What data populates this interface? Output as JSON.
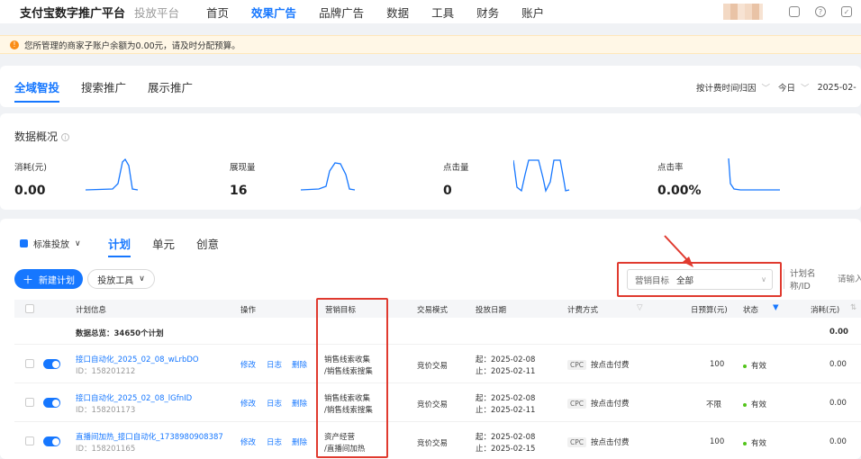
{
  "topbar": {
    "brand": "支付宝数字推广平台",
    "sub": "投放平台",
    "nav": [
      "首页",
      "效果广告",
      "品牌广告",
      "数据",
      "工具",
      "财务",
      "账户"
    ],
    "active_nav": "效果广告"
  },
  "notice": {
    "text": "您所管理的商家子账户余额为0.00元，请及时分配预算。"
  },
  "main_tabs": [
    "全域智投",
    "搜索推广",
    "展示推广"
  ],
  "tabs_right": {
    "attribution": "按计费时间归因",
    "date_range": "今日",
    "date": "2025-02-"
  },
  "overview": {
    "title": "数据概况",
    "metrics": [
      {
        "label": "消耗(元)",
        "value": "0.00"
      },
      {
        "label": "展现量",
        "value": "16"
      },
      {
        "label": "点击量",
        "value": "0"
      },
      {
        "label": "点击率",
        "value": "0.00%"
      }
    ]
  },
  "toolbar": {
    "mode": "标准投放",
    "sub_tabs": [
      "计划",
      "单元",
      "创意"
    ],
    "new_plan": "新建计划",
    "tools": "投放工具",
    "filter_label": "营销目标",
    "filter_value": "全部",
    "search_label": "计划名称/ID",
    "search_placeholder": "请输入"
  },
  "table": {
    "headers": {
      "plan": "计划信息",
      "ops": "操作",
      "goal": "营销目标",
      "trade": "交易模式",
      "date": "投放日期",
      "billing": "计费方式",
      "budget": "日预算(元)",
      "status": "状态",
      "cost": "消耗(元)"
    },
    "summary_label": "数据总览：34650个计划",
    "summary_cost": "0.00",
    "op_labels": [
      "修改",
      "日志",
      "删除"
    ],
    "rows": [
      {
        "name": "接口自动化_2025_02_08_wLrbDO",
        "id": "ID：158201212",
        "goal1": "销售线索收集",
        "goal2": "/销售线索搜集",
        "trade": "竞价交易",
        "start": "起：2025-02-08",
        "end": "止：2025-02-11",
        "billing_tag": "CPC",
        "billing": "按点击付费",
        "budget": "100",
        "status": "有效",
        "cost": "0.00"
      },
      {
        "name": "接口自动化_2025_02_08_lGfnID",
        "id": "ID：158201173",
        "goal1": "销售线索收集",
        "goal2": "/销售线索搜集",
        "trade": "竞价交易",
        "start": "起：2025-02-08",
        "end": "止：2025-02-11",
        "billing_tag": "CPC",
        "billing": "按点击付费",
        "budget": "不限",
        "status": "有效",
        "cost": "0.00"
      },
      {
        "name": "直播间加热_接口自动化_1738980908387",
        "id": "ID：158201165",
        "goal1": "资产经营",
        "goal2": "/直播间加热",
        "trade": "竞价交易",
        "start": "起：2025-02-08",
        "end": "止：2025-02-15",
        "billing_tag": "CPC",
        "billing": "按点击付费",
        "budget": "100",
        "status": "有效",
        "cost": "0.00"
      }
    ]
  },
  "colors": {
    "accent": "#1677ff",
    "highlight": "#e03a2f",
    "warning_bg": "#fff7e6"
  }
}
